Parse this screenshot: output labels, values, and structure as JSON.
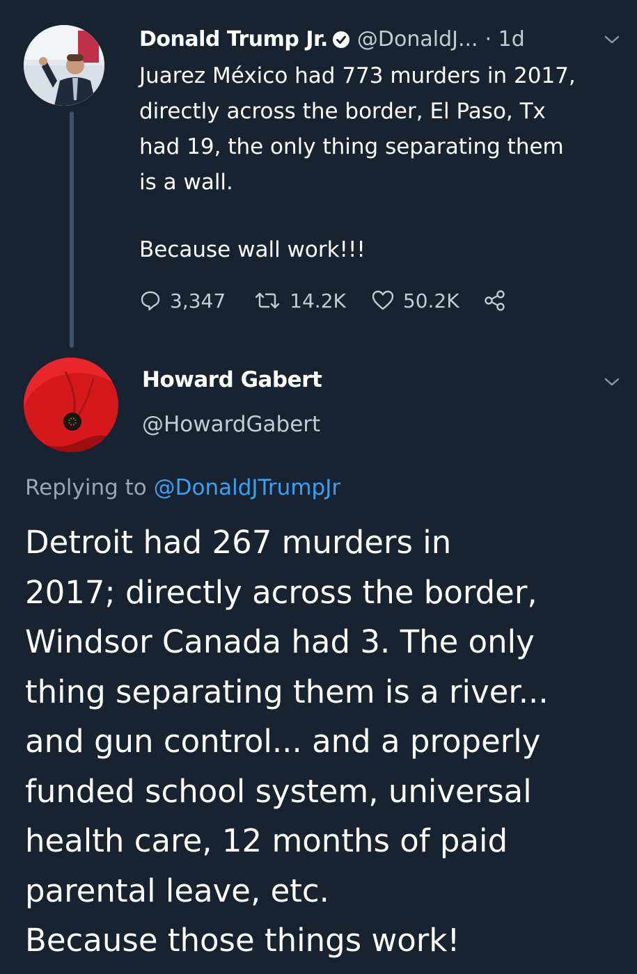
{
  "tweet1": {
    "author_name": "Donald Trump Jr.",
    "handle": "@DonaldJ...",
    "time": "· 1d",
    "text_lines": [
      "Juarez México had 773 murders in 2017,",
      "directly across the border, El Paso, Tx",
      "had 19, the only thing separating them",
      "is a wall."
    ],
    "text_tail": "Because wall work!!!",
    "stats": {
      "replies": "3,347",
      "retweets": "14.2K",
      "likes": "50.2K"
    }
  },
  "tweet2": {
    "author_name": "Howard Gabert",
    "handle": "@HowardGabert",
    "replying_prefix": "Replying to",
    "replying_handle": "@DonaldJTrumpJr",
    "text_lines": [
      "Detroit had 267 murders in",
      "2017; directly across the border,",
      "Windsor Canada had 3.  The only",
      "thing separating them is a river...",
      "and gun control... and a properly",
      "funded school system, universal",
      "health care, 12 months of paid",
      "parental leave, etc.",
      "Because those things work!"
    ]
  },
  "colors": {
    "background": "#172331",
    "text_primary": "#ffffff",
    "text_secondary": "#c4ccd3",
    "link": "#3ea0ee",
    "thread_line": "#3d5466"
  },
  "icons": {
    "verified": "verified-badge-icon",
    "caret": "chevron-down-icon",
    "reply": "reply-bubble-icon",
    "retweet": "retweet-icon",
    "like": "heart-icon",
    "share": "share-icon"
  }
}
